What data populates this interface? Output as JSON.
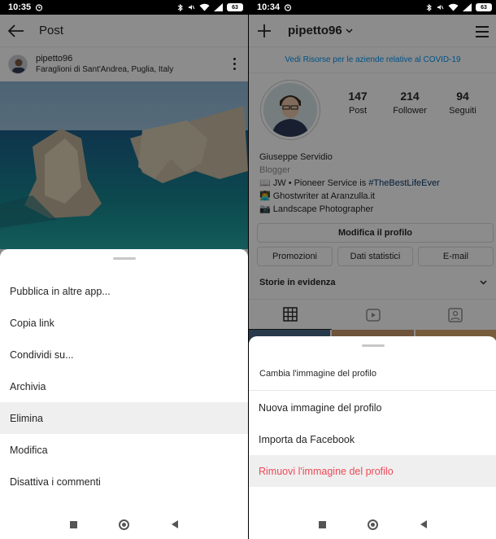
{
  "left": {
    "status": {
      "time": "10:35",
      "battery": "63"
    },
    "header": {
      "title": "Post"
    },
    "post": {
      "username": "pipetto96",
      "location": "Faraglioni di Sant'Andrea, Puglia, Italy"
    },
    "sheet": {
      "items": [
        {
          "label": "Pubblica in altre app..."
        },
        {
          "label": "Copia link"
        },
        {
          "label": "Condividi su..."
        },
        {
          "label": "Archivia"
        },
        {
          "label": "Elimina"
        },
        {
          "label": "Modifica"
        },
        {
          "label": "Disattiva i commenti"
        }
      ]
    }
  },
  "right": {
    "status": {
      "time": "10:34",
      "battery": "63"
    },
    "header": {
      "username": "pipetto96"
    },
    "covid_banner": "Vedi Risorse per le aziende relative al COVID-19",
    "stats": [
      {
        "value": "147",
        "label": "Post"
      },
      {
        "value": "214",
        "label": "Follower"
      },
      {
        "value": "94",
        "label": "Seguiti"
      }
    ],
    "bio": {
      "name": "Giuseppe Servidio",
      "category": "Blogger",
      "line1_prefix": "📖 JW • Pioneer Service is ",
      "line1_tag": "#TheBestLifeEver",
      "line2": "👨‍💻 Ghostwriter at Aranzulla.it",
      "line3": "📷 Landscape Photographer"
    },
    "buttons": {
      "edit": "Modifica il profilo",
      "promo": "Promozioni",
      "stats": "Dati statistici",
      "email": "E-mail"
    },
    "highlights_label": "Storie in evidenza",
    "sheet": {
      "title": "Cambia l'immagine del profilo",
      "items": [
        {
          "label": "Nuova immagine del profilo"
        },
        {
          "label": "Importa da Facebook"
        },
        {
          "label": "Rimuovi l'immagine del profilo"
        }
      ]
    }
  },
  "colors": {
    "accent_blue": "#0095f6",
    "danger": "#ed4956",
    "overlay": "rgba(0,0,0,0.45)"
  }
}
